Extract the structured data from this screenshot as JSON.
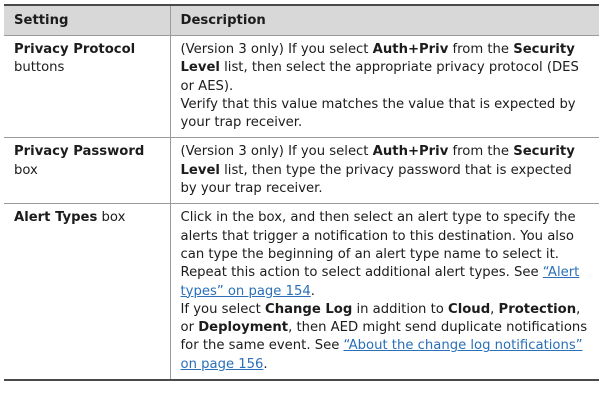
{
  "headers": {
    "setting": "Setting",
    "description": "Description"
  },
  "rows": [
    {
      "setting_bold": "Privacy Protocol",
      "setting_rest": "buttons",
      "desc": {
        "p1_a": "(Version 3 only) If you select ",
        "p1_b": "Auth+Priv",
        "p1_c": " from the ",
        "p1_d": "Security Level",
        "p1_e": " list, then select the appropriate privacy protocol (DES or AES).",
        "p2": "Verify that this value matches the value that is expected by your trap receiver."
      }
    },
    {
      "setting_bold": "Privacy Password",
      "setting_rest": "box",
      "desc": {
        "p1_a": "(Version 3 only) If you select ",
        "p1_b": "Auth+Priv",
        "p1_c": " from the ",
        "p1_d": "Security Level",
        "p1_e": " list, then type the privacy password that is expected by your trap receiver."
      }
    },
    {
      "setting_bold": "Alert Types",
      "setting_rest": " box",
      "desc": {
        "p1_a": "Click in the box, and then select an alert type to specify the alerts that trigger a notification to this destination. You also can type the beginning of an alert type name to select it. Repeat this action to select additional alert types. See ",
        "p1_link": "“Alert types” on page 154",
        "p1_end": ".",
        "p2_a": "If you select ",
        "p2_b": "Change Log",
        "p2_c": " in addition to ",
        "p2_d": "Cloud",
        "p2_e": ", ",
        "p2_f": "Protection",
        "p2_g": ", or ",
        "p2_h": "Deployment",
        "p2_i": ", then AED might send duplicate notifications for the same event. See ",
        "p2_link": "“About the change log notifications” on page 156",
        "p2_end": "."
      }
    }
  ],
  "colors": {
    "header_bg": "#d8d8d8",
    "link": "#2a6fb8",
    "rule": "#4a4a4a"
  }
}
